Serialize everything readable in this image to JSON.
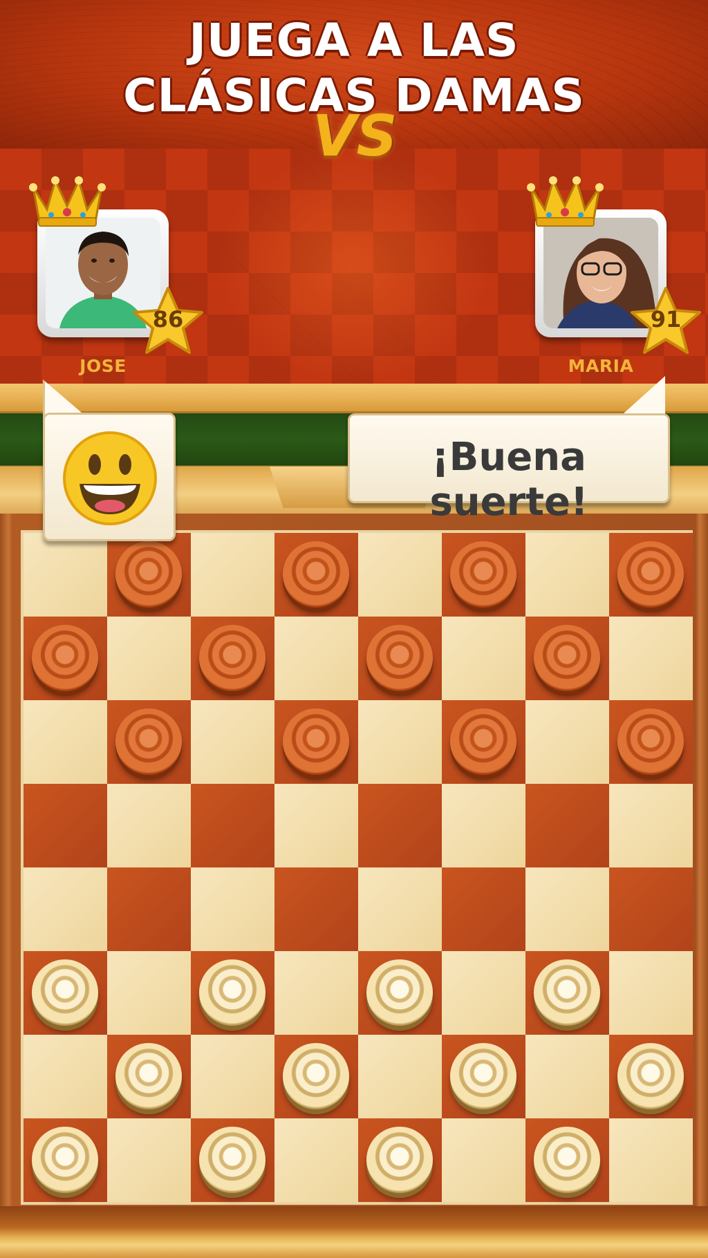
{
  "header": {
    "title_line1": "JUEGA A LAS",
    "title_line2": "CLÁSICAS DAMAS"
  },
  "versus_label": "VS",
  "players": [
    {
      "name": "JOSE",
      "level": "86",
      "crown": true
    },
    {
      "name": "MARIA",
      "level": "91",
      "crown": true
    }
  ],
  "chat": {
    "emoji": "grinning-face",
    "message": "¡Buena suerte!"
  },
  "board": {
    "size": 8,
    "pieces_red": [
      "b8",
      "d8",
      "f8",
      "h8",
      "a7",
      "c7",
      "e7",
      "g7",
      "b6",
      "d6",
      "f6",
      "h6"
    ],
    "pieces_white": [
      "a3",
      "c3",
      "e3",
      "g3",
      "b2",
      "d2",
      "f2",
      "h2",
      "a1",
      "c1",
      "e1",
      "g1"
    ]
  },
  "colors": {
    "dark_square": "#b2431a",
    "light_square": "#f3dfad",
    "red_piece": "#d36a2c",
    "white_piece": "#f4e2b0"
  }
}
